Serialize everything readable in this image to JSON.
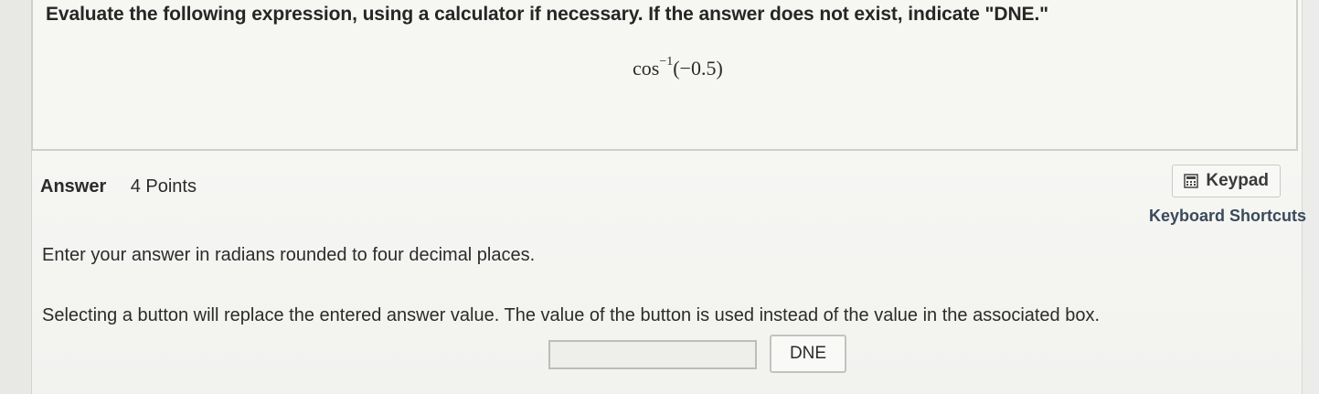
{
  "question": {
    "prompt": "Evaluate the following expression, using a calculator if necessary. If the answer does not exist, indicate \"DNE.\"",
    "expression_func": "cos",
    "expression_sup": "−1",
    "expression_arg": "(−0.5)"
  },
  "answer": {
    "label": "Answer",
    "points": "4 Points",
    "instruction": "Enter your answer in radians rounded to four decimal places.",
    "button_note": "Selecting a button will replace the entered answer value. The value of the button is used instead of the value in the associated box.",
    "input_value": "",
    "dne_label": "DNE"
  },
  "tools": {
    "keypad_label": "Keypad",
    "keypad_icon": "calculator-icon",
    "shortcuts_label": "Keyboard Shortcuts"
  }
}
